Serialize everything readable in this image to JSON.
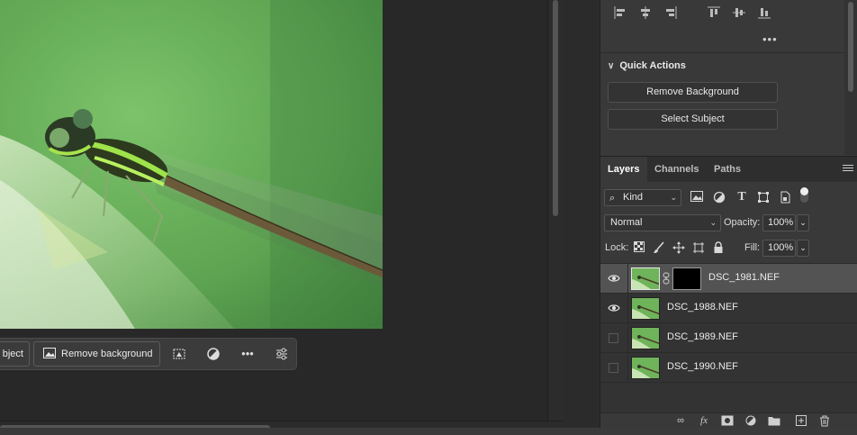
{
  "taskbar": {
    "select_subject_label": "bject",
    "remove_background_label": "Remove background",
    "icons": [
      "select-subject-icon",
      "remove-background-icon",
      "mask-icon",
      "adjustment-icon",
      "more-icon",
      "settings-icon"
    ]
  },
  "properties": {
    "quick_actions_title": "Quick Actions",
    "remove_background_button": "Remove Background",
    "select_subject_button": "Select Subject",
    "more_label": "•••"
  },
  "layers_panel": {
    "tabs": [
      {
        "label": "Layers",
        "active": true
      },
      {
        "label": "Channels",
        "active": false
      },
      {
        "label": "Paths",
        "active": false
      }
    ],
    "filter": {
      "kind_label": "Kind"
    },
    "blend_mode": "Normal",
    "opacity_label": "Opacity:",
    "opacity_value": "100%",
    "lock_label": "Lock:",
    "fill_label": "Fill:",
    "fill_value": "100%",
    "layers": [
      {
        "name": "DSC_1981.NEF",
        "visible": true,
        "selected": true,
        "has_mask": true
      },
      {
        "name": "DSC_1988.NEF",
        "visible": true,
        "selected": false,
        "has_mask": false
      },
      {
        "name": "DSC_1989.NEF",
        "visible": false,
        "selected": false,
        "has_mask": false
      },
      {
        "name": "DSC_1990.NEF",
        "visible": false,
        "selected": false,
        "has_mask": false
      }
    ]
  },
  "colors": {
    "panel_bg": "#393939",
    "selected_row": "#535353",
    "photo_green": "#6fb35a"
  }
}
